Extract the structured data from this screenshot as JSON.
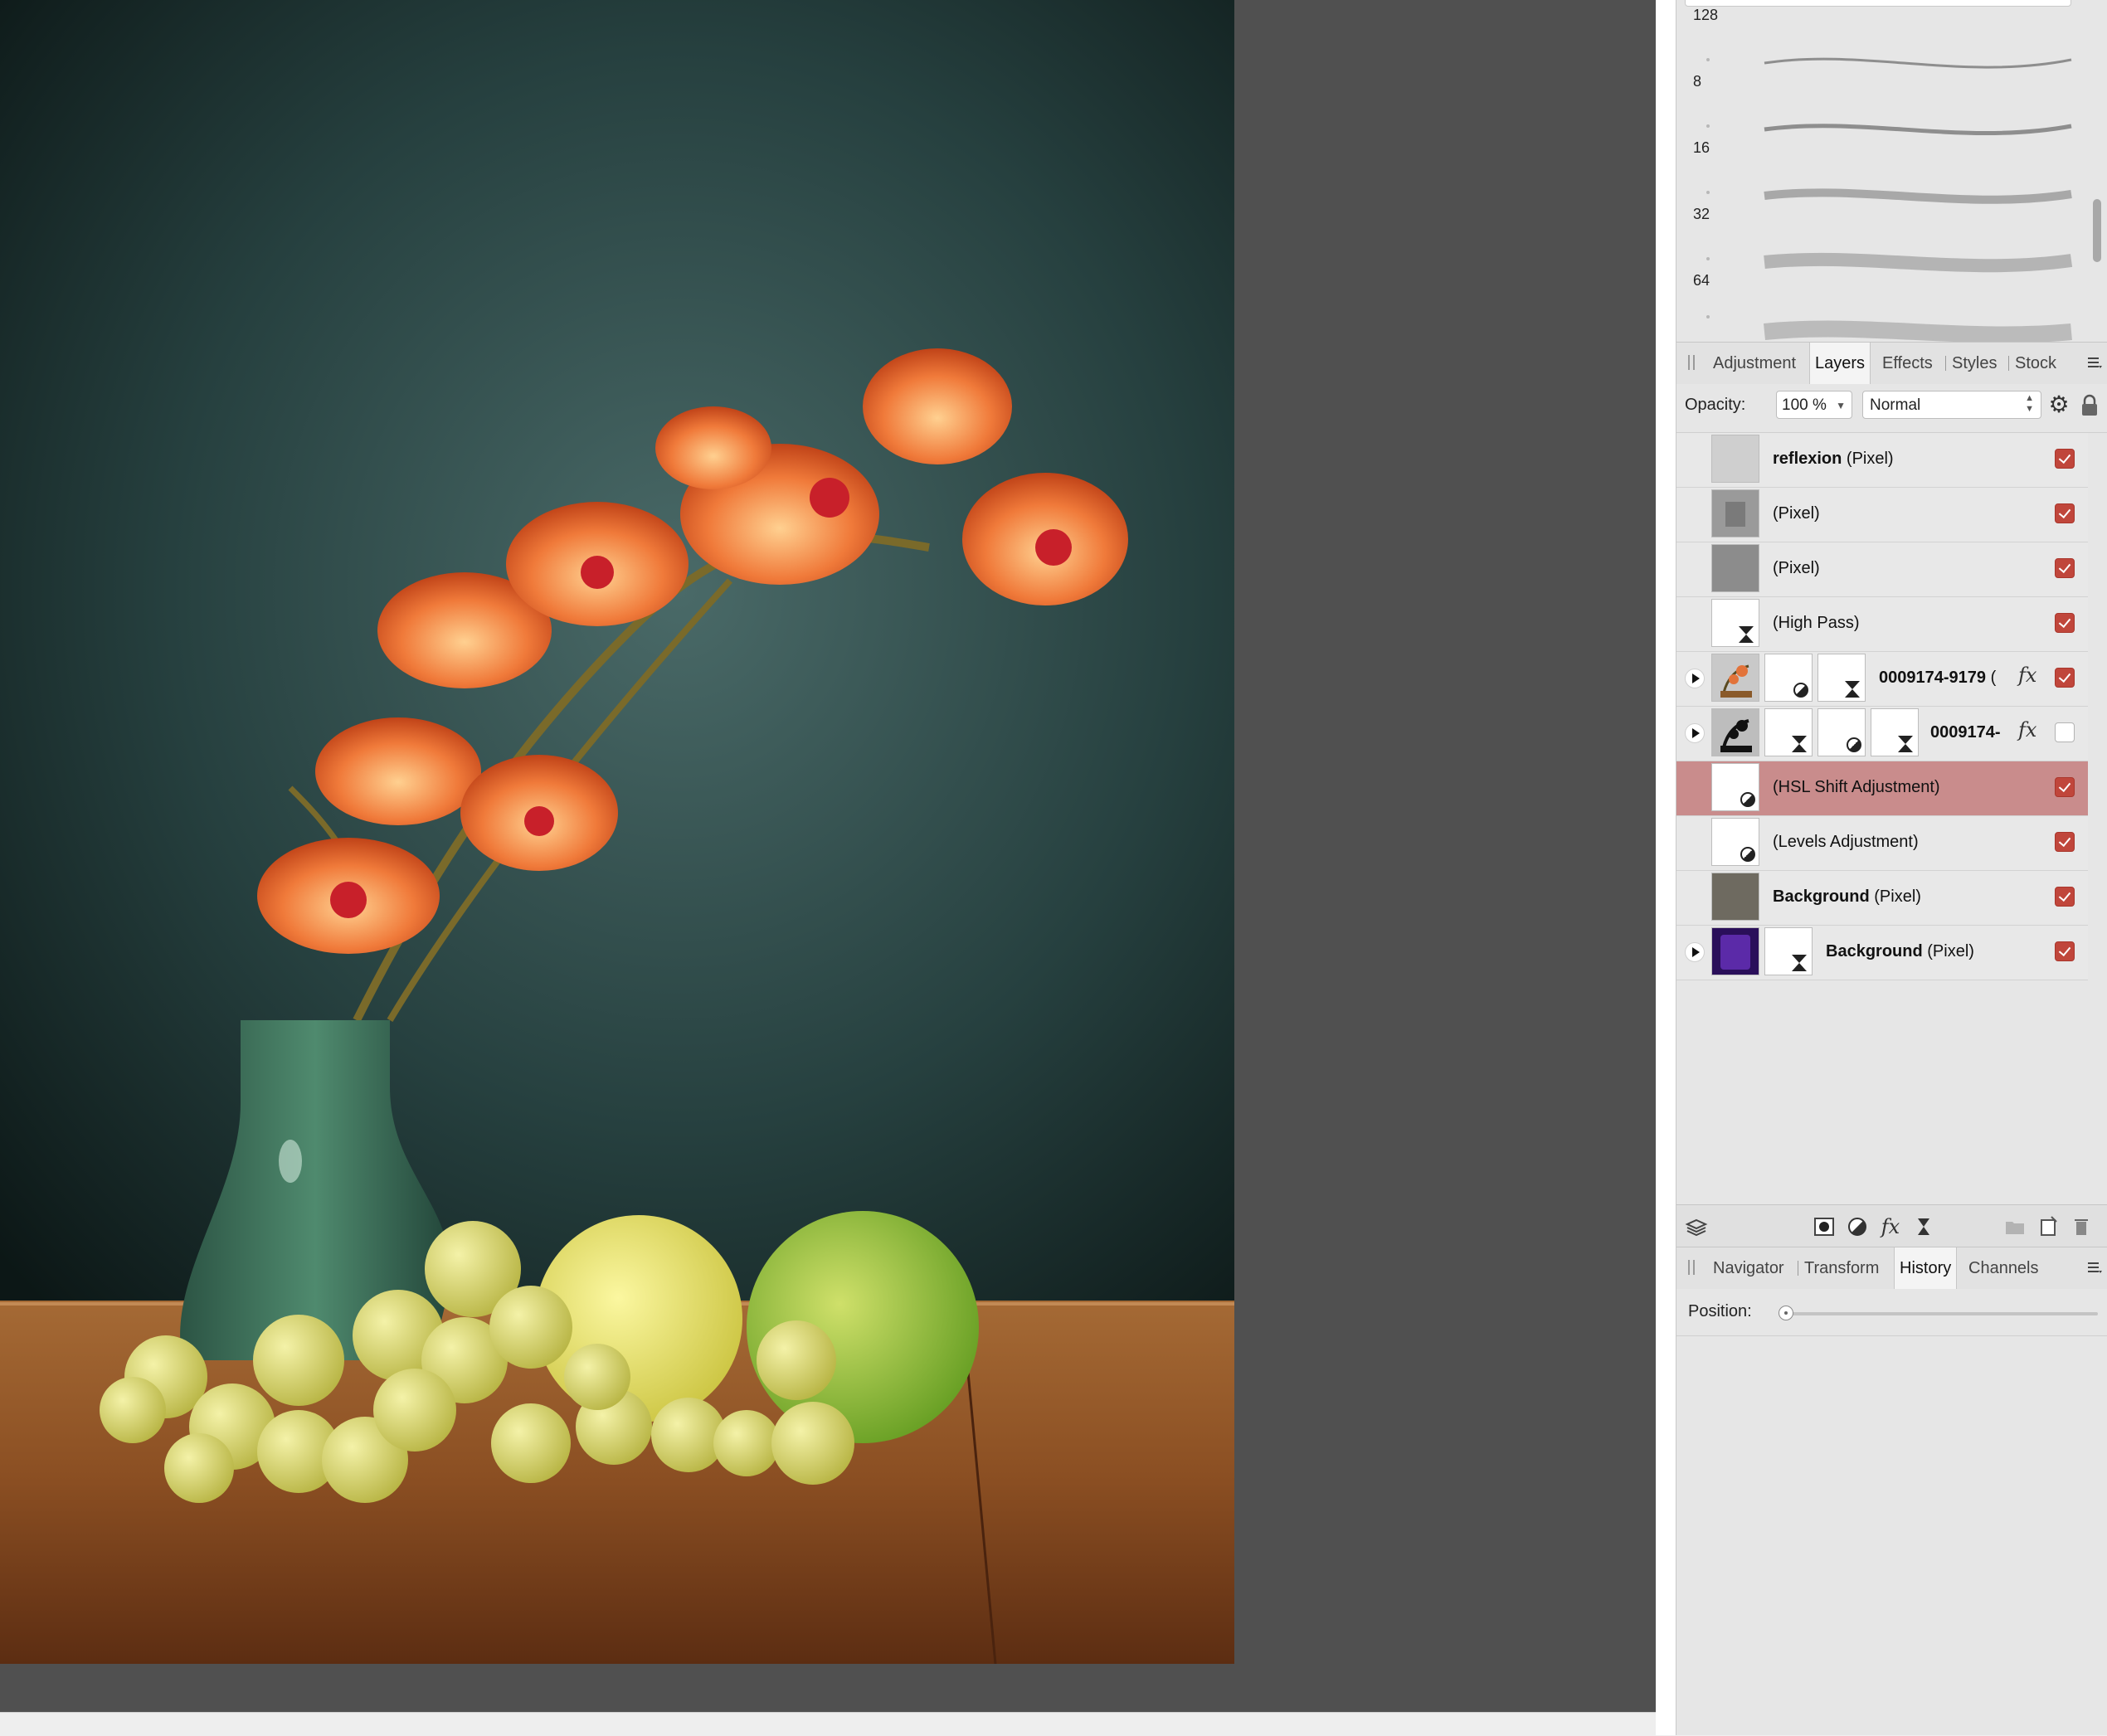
{
  "brushes": {
    "sizes": [
      "128",
      "8",
      "16",
      "32",
      "64"
    ]
  },
  "layers_tabs": [
    {
      "label": "Adjustment",
      "selected": false
    },
    {
      "label": "Layers",
      "selected": true
    },
    {
      "label": "Effects",
      "selected": false
    },
    {
      "label": "Styles",
      "selected": false
    },
    {
      "label": "Stock",
      "selected": false
    }
  ],
  "layer_options": {
    "opacity_label": "Opacity:",
    "opacity_value": "100 %",
    "blend_mode": "Normal"
  },
  "layers": [
    {
      "name": "reflexion",
      "type": "(Pixel)",
      "visible": true
    },
    {
      "name": "",
      "type": "(Pixel)",
      "visible": true
    },
    {
      "name": "",
      "type": "(Pixel)",
      "visible": true
    },
    {
      "name": "",
      "type": "(High Pass)",
      "visible": true
    },
    {
      "name": "0009174-9179",
      "type": "(",
      "visible": true,
      "fx": "fx"
    },
    {
      "name": "0009174-",
      "type": "",
      "visible": false,
      "fx": "fx"
    },
    {
      "name": "",
      "type": "(HSL Shift Adjustment)",
      "visible": true,
      "selected": true
    },
    {
      "name": "",
      "type": "(Levels Adjustment)",
      "visible": true
    },
    {
      "name": "Background",
      "type": "(Pixel)",
      "visible": true
    },
    {
      "name": "Background",
      "type": "(Pixel)",
      "visible": true
    }
  ],
  "history_tabs": [
    {
      "label": "Navigator",
      "selected": false
    },
    {
      "label": "Transform",
      "selected": false
    },
    {
      "label": "History",
      "selected": true
    },
    {
      "label": "Channels",
      "selected": false
    }
  ],
  "history": {
    "position_label": "Position:"
  },
  "colors": {
    "selected_row": "#c98c8c",
    "checkbox_on": "#c0463b",
    "canvas_bg": "#505050"
  }
}
